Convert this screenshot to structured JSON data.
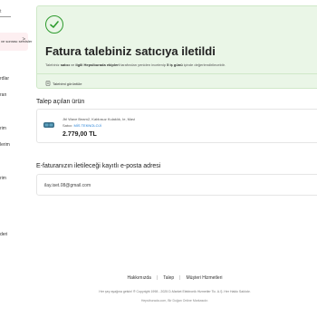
{
  "sidebar": {
    "brand": "t",
    "active_item": {
      "label": "ve sonrası servisler",
      "chevron": ">"
    },
    "items": [
      {
        "label": "rdlar"
      },
      {
        "label": "ran"
      },
      {
        "label": "rim"
      },
      {
        "label": "lerim"
      },
      {
        "label": "rim"
      },
      {
        "label": "deri"
      }
    ]
  },
  "success": {
    "title": "Fatura talebiniz satıcıya iletildi",
    "desc_part1": "Talebiniz ",
    "desc_bold1": "satıcı",
    "desc_part2": " ve ",
    "desc_bold2": "ilgili Hepsiburada ekipleri",
    "desc_part3": " tarafından yeniden incelenip ",
    "desc_bold3": "5 iş günü",
    "desc_part4": " içinde değerlendirilecektir.",
    "view_label": "Talebimi görüntüle",
    "accent": "#2e9b2e"
  },
  "product_section": {
    "title": "Talep açılan ürün",
    "product": {
      "name": "Jbl Wave Beam2, Kablosuz Kulaklık, Ie, Mavi",
      "seller_label": "Satıcı: ",
      "seller_name": "MİS TEKNOLOJİ",
      "price": "2.779,00 TL"
    }
  },
  "email_section": {
    "title": "E-faturanızın iletileceği kayıtlı e-posta adresi",
    "email": "ilay.iset.08@gmail.com"
  },
  "footer": {
    "links": [
      "Hakkımızda",
      "Talep",
      "Müşteri Hizmetleri"
    ],
    "separator": "|",
    "copyright": "Her şey ayağına gelsin! ® Copyright 1998 - 2025 D-Market Elektronik Hizmetler Tic. A.Ş. Her Hakkı Saklıdır.",
    "domain_line": "Hepsiburada.com, Bir Doğan Online Markasıdır."
  }
}
